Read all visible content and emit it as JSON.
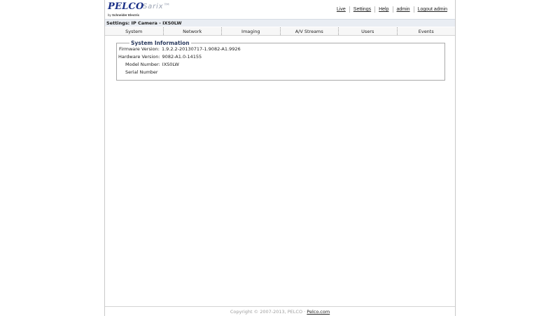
{
  "brand": {
    "name": "PELCO",
    "product": "Sarix™",
    "by_prefix": "by",
    "by_company": "Schneider Electric"
  },
  "toplinks": [
    {
      "label": "Live"
    },
    {
      "label": "Settings"
    },
    {
      "label": "Help"
    },
    {
      "label": "admin"
    },
    {
      "label": "Logout admin"
    }
  ],
  "page_title": "Settings: IP Camera - IXS0LW",
  "tabs": [
    {
      "label": "System"
    },
    {
      "label": "Network"
    },
    {
      "label": "Imaging"
    },
    {
      "label": "A/V Streams"
    },
    {
      "label": "Users"
    },
    {
      "label": "Events"
    }
  ],
  "system_info": {
    "heading": "System Information",
    "firmware_label": "Firmware Version:",
    "firmware_value": "1.9.2.2-20130717-1.9082-A1.9926",
    "hardware_label": "Hardware Version:",
    "hardware_value": "9082-A1.0-14155",
    "model_label": "Model Number:",
    "model_value": "IXS0LW",
    "serial_label": "Serial Number",
    "serial_value": ""
  },
  "footer": {
    "copyright": "Copyright © 2007-2013, PELCO",
    "separator": " · ",
    "link": "Pelco.com"
  }
}
